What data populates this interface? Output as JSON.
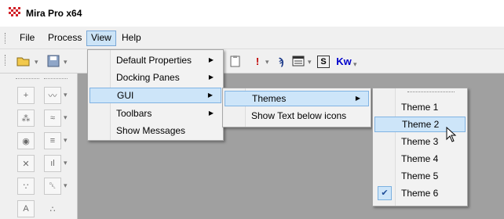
{
  "window": {
    "title": "Mira Pro x64"
  },
  "menubar": {
    "items": [
      "File",
      "Process",
      "View",
      "Help"
    ]
  },
  "view_menu": {
    "items": [
      {
        "label": "Default Properties",
        "has_submenu": true
      },
      {
        "label": "Docking Panes",
        "has_submenu": true
      },
      {
        "label": "GUI",
        "has_submenu": true
      },
      {
        "label": "Toolbars",
        "has_submenu": true
      },
      {
        "label": "Show Messages",
        "has_submenu": false
      }
    ]
  },
  "gui_menu": {
    "items": [
      {
        "label": "Themes",
        "has_submenu": true
      },
      {
        "label": "Show Text below icons",
        "has_submenu": false
      }
    ]
  },
  "themes_menu": {
    "items": [
      "Theme 1",
      "Theme 2",
      "Theme 3",
      "Theme 4",
      "Theme 5",
      "Theme 6"
    ],
    "highlighted": "Theme 2",
    "checked": "Theme 6"
  },
  "toolbar": {
    "icons": [
      "open-folder-icon",
      "save-icon",
      "paste-icon",
      "alert-icon",
      "glasses-icon",
      "form-icon",
      "s-icon",
      "kw-icon"
    ],
    "glyphs": {
      "alert": "!",
      "s": "S",
      "kw": "Kw"
    }
  },
  "colors": {
    "accent": "#cde5f9",
    "highlight_border": "#80b3e3",
    "alert": "#c00000",
    "kw": "#0000cc"
  }
}
